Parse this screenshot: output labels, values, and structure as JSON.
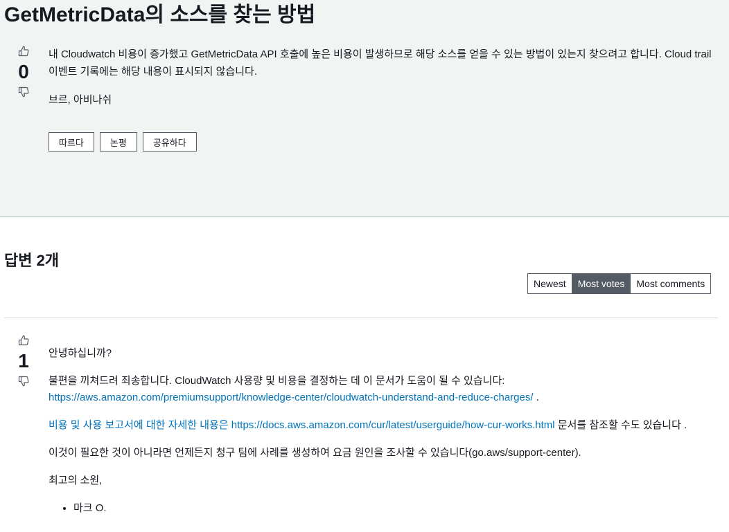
{
  "question": {
    "title": "GetMetricData의 소스를 찾는 방법",
    "votes": "0",
    "body": "내 Cloudwatch 비용이 증가했고 GetMetricData API 호출에 높은 비용이 발생하므로 해당 소스를 얻을 수 있는 방법이 있는지 찾으려고 합니다. Cloud trail 이벤트 기록에는 해당 내용이 표시되지 않습니다.",
    "tags": "브르, 아비나쉬",
    "actions": {
      "follow": "따르다",
      "comment": "논평",
      "share": "공유하다"
    }
  },
  "answers": {
    "heading": "답변 2개",
    "sort": {
      "newest": "Newest",
      "most_votes": "Most votes",
      "most_comments": "Most comments",
      "active": "Most votes"
    }
  },
  "answer1": {
    "votes": "1",
    "greeting": "안녕하십니까?",
    "p2_text": "불편을 끼쳐드려 죄송합니다. CloudWatch 사용량 및 비용을 결정하는 데 이 문서가 도움이 될 수 있습니다:",
    "p2_link": "https://aws.amazon.com/premiumsupport/knowledge-center/cloudwatch-understand-and-reduce-charges/",
    "p2_end": " .",
    "p3_prefix": "비용 및 사용 보고서에 대한 자세한 내용은 ",
    "p3_link": "https://docs.aws.amazon.com/cur/latest/userguide/how-cur-works.html",
    "p3_suffix": " 문서를 참조할 수도 있습니다 .",
    "p4": "이것이 필요한 것이 아니라면 언제든지 청구 팀에 사례를 생성하여 요금 원인을 조사할 수 있습니다(go.aws/support-center).",
    "p5": "최고의 소원,",
    "signoff_item": "마크 O."
  },
  "icons": {
    "upvote": "thumbs-up-icon",
    "downvote": "thumbs-down-icon"
  },
  "colors": {
    "panel_bg": "#f2f3f3",
    "link": "#0073bb",
    "active_sort_bg": "#545b64"
  }
}
